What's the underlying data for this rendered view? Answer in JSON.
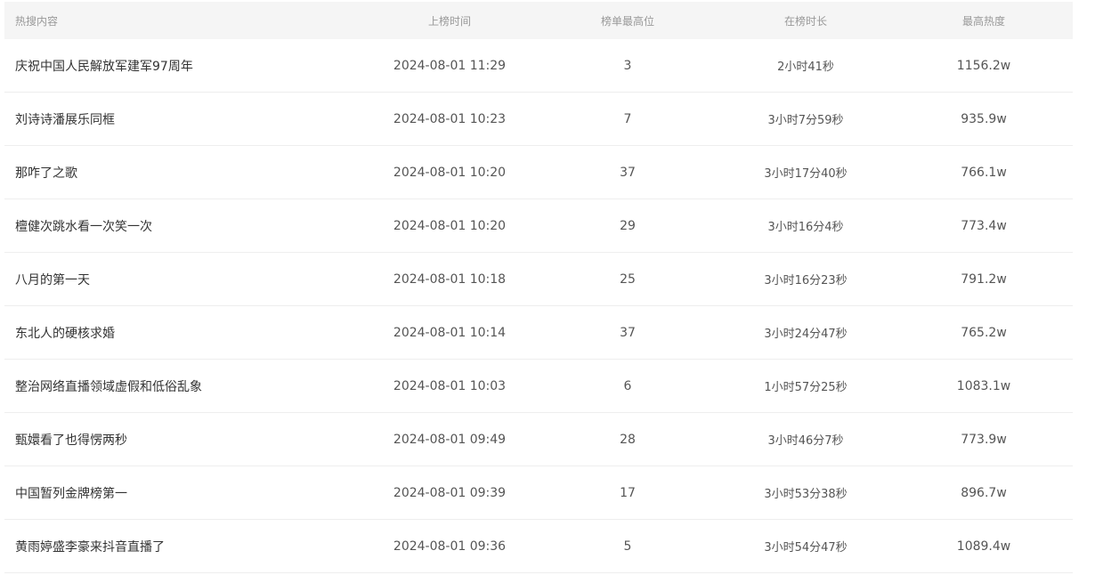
{
  "columns": {
    "topic": "热搜内容",
    "listed_time": "上榜时间",
    "peak_rank": "榜单最高位",
    "duration": "在榜时长",
    "peak_heat": "最高热度"
  },
  "rows": [
    {
      "topic": "庆祝中国人民解放军建军97周年",
      "listed_time": "2024-08-01 11:29",
      "peak_rank": "3",
      "duration": "2小时41秒",
      "peak_heat": "1156.2w"
    },
    {
      "topic": "刘诗诗潘展乐同框",
      "listed_time": "2024-08-01 10:23",
      "peak_rank": "7",
      "duration": "3小时7分59秒",
      "peak_heat": "935.9w"
    },
    {
      "topic": "那咋了之歌",
      "listed_time": "2024-08-01 10:20",
      "peak_rank": "37",
      "duration": "3小时17分40秒",
      "peak_heat": "766.1w"
    },
    {
      "topic": "檀健次跳水看一次笑一次",
      "listed_time": "2024-08-01 10:20",
      "peak_rank": "29",
      "duration": "3小时16分4秒",
      "peak_heat": "773.4w"
    },
    {
      "topic": "八月的第一天",
      "listed_time": "2024-08-01 10:18",
      "peak_rank": "25",
      "duration": "3小时16分23秒",
      "peak_heat": "791.2w"
    },
    {
      "topic": "东北人的硬核求婚",
      "listed_time": "2024-08-01 10:14",
      "peak_rank": "37",
      "duration": "3小时24分47秒",
      "peak_heat": "765.2w"
    },
    {
      "topic": "整治网络直播领域虚假和低俗乱象",
      "listed_time": "2024-08-01 10:03",
      "peak_rank": "6",
      "duration": "1小时57分25秒",
      "peak_heat": "1083.1w"
    },
    {
      "topic": "甄嬛看了也得愣两秒",
      "listed_time": "2024-08-01 09:49",
      "peak_rank": "28",
      "duration": "3小时46分7秒",
      "peak_heat": "773.9w"
    },
    {
      "topic": "中国暂列金牌榜第一",
      "listed_time": "2024-08-01 09:39",
      "peak_rank": "17",
      "duration": "3小时53分38秒",
      "peak_heat": "896.7w"
    },
    {
      "topic": "黄雨婷盛李豪来抖音直播了",
      "listed_time": "2024-08-01 09:36",
      "peak_rank": "5",
      "duration": "3小时54分47秒",
      "peak_heat": "1089.4w"
    }
  ]
}
